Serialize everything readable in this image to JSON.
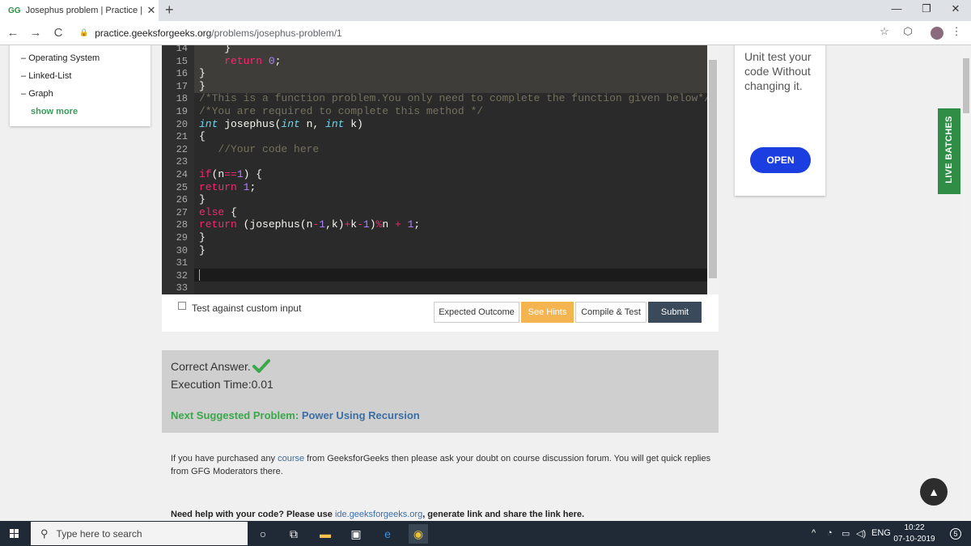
{
  "browser": {
    "tab_favicon": "GG",
    "tab_title": "Josephus problem | Practice | Ge",
    "tab_close": "✕",
    "new_tab": "+",
    "win_min": "—",
    "win_restore": "❐",
    "win_close": "✕",
    "back": "←",
    "forward": "→",
    "reload": "C",
    "url_domain": "practice.geeksforgeeks.org",
    "url_path": "/problems/josephus-problem/1",
    "star": "☆",
    "shield": "⬡",
    "menu": "⋮"
  },
  "left_panel": {
    "items": [
      "Operating System",
      "Linked-List",
      "Graph"
    ],
    "show_more": "show more"
  },
  "editor": {
    "lines": [
      {
        "n": "14",
        "code": [
          {
            "t": "    }",
            "c": ""
          }
        ]
      },
      {
        "n": "15",
        "code": [
          {
            "t": "    ",
            "c": ""
          },
          {
            "t": "return",
            "c": "ret"
          },
          {
            "t": " ",
            "c": ""
          },
          {
            "t": "0",
            "c": "num"
          },
          {
            "t": ";",
            "c": ""
          }
        ]
      },
      {
        "n": "16",
        "code": [
          {
            "t": "}",
            "c": ""
          }
        ]
      },
      {
        "n": "17",
        "code": [
          {
            "t": "}",
            "c": ""
          }
        ]
      },
      {
        "n": "18",
        "code": [
          {
            "t": "/*This is a function problem.You only need to complete the function given below*/",
            "c": "cm"
          }
        ]
      },
      {
        "n": "19",
        "code": [
          {
            "t": "/*You are required to complete this method */",
            "c": "cm"
          }
        ]
      },
      {
        "n": "20",
        "code": [
          {
            "t": "int",
            "c": "kw"
          },
          {
            "t": " josephus(",
            "c": ""
          },
          {
            "t": "int",
            "c": "kw"
          },
          {
            "t": " n, ",
            "c": ""
          },
          {
            "t": "int",
            "c": "kw"
          },
          {
            "t": " k)",
            "c": ""
          }
        ]
      },
      {
        "n": "21",
        "code": [
          {
            "t": "{",
            "c": ""
          }
        ]
      },
      {
        "n": "22",
        "code": [
          {
            "t": "   //Your code here",
            "c": "cm"
          }
        ]
      },
      {
        "n": "23",
        "code": []
      },
      {
        "n": "24",
        "code": [
          {
            "t": "if",
            "c": "ret"
          },
          {
            "t": "(n",
            "c": ""
          },
          {
            "t": "==",
            "c": "op"
          },
          {
            "t": "1",
            "c": "num"
          },
          {
            "t": ") {",
            "c": ""
          }
        ]
      },
      {
        "n": "25",
        "code": [
          {
            "t": "return",
            "c": "ret"
          },
          {
            "t": " ",
            "c": ""
          },
          {
            "t": "1",
            "c": "num"
          },
          {
            "t": ";",
            "c": ""
          }
        ]
      },
      {
        "n": "26",
        "code": [
          {
            "t": "}",
            "c": ""
          }
        ]
      },
      {
        "n": "27",
        "code": [
          {
            "t": "else",
            "c": "ret"
          },
          {
            "t": " {",
            "c": ""
          }
        ]
      },
      {
        "n": "28",
        "code": [
          {
            "t": "return",
            "c": "ret"
          },
          {
            "t": " (josephus(n",
            "c": ""
          },
          {
            "t": "-",
            "c": "op"
          },
          {
            "t": "1",
            "c": "num"
          },
          {
            "t": ",k)",
            "c": ""
          },
          {
            "t": "+",
            "c": "op"
          },
          {
            "t": "k",
            "c": ""
          },
          {
            "t": "-",
            "c": "op"
          },
          {
            "t": "1",
            "c": "num"
          },
          {
            "t": ")",
            "c": ""
          },
          {
            "t": "%",
            "c": "op"
          },
          {
            "t": "n ",
            "c": ""
          },
          {
            "t": "+",
            "c": "op"
          },
          {
            "t": " ",
            "c": ""
          },
          {
            "t": "1",
            "c": "num"
          },
          {
            "t": ";",
            "c": ""
          }
        ]
      },
      {
        "n": "29",
        "code": [
          {
            "t": "}",
            "c": ""
          }
        ]
      },
      {
        "n": "30",
        "code": [
          {
            "t": "}",
            "c": ""
          }
        ]
      },
      {
        "n": "31",
        "code": []
      },
      {
        "n": "32",
        "code": []
      },
      {
        "n": "33",
        "code": []
      }
    ]
  },
  "controls": {
    "custom_input_label": "Test against custom input",
    "expected_outcome": "Expected Outcome",
    "see_hints": "See Hints",
    "compile_test": "Compile & Test",
    "submit": "Submit"
  },
  "result": {
    "status": "Correct Answer.",
    "exec_time": "Execution Time:0.01",
    "next_label": "Next Suggested Problem: ",
    "next_link": "Power Using Recursion"
  },
  "note": {
    "part1": "If you have purchased any ",
    "link": "course",
    "part2": " from GeeksforGeeks then please ask your doubt on course discussion forum. You will get quick replies from GFG Moderators there."
  },
  "help": {
    "part1": "Need help with your code? Please use ",
    "link": "ide.geeksforgeeks.org",
    "part2": ", generate link and share the link here."
  },
  "ad": {
    "text": "Unit test your code Without changing it.",
    "button": "OPEN"
  },
  "live_batches": "LIVE BATCHES",
  "scroll_top": "▲",
  "taskbar": {
    "search_placeholder": "Type here to search",
    "lang": "ENG",
    "time": "10:22",
    "date": "07-10-2019",
    "notif_count": "5"
  },
  "colors": {
    "accent_green": "#2f8d46",
    "hint_orange": "#f4b44f",
    "submit_navy": "#3b4a5a",
    "link_blue": "#3b6ea5",
    "open_blue": "#1a3ee0"
  }
}
